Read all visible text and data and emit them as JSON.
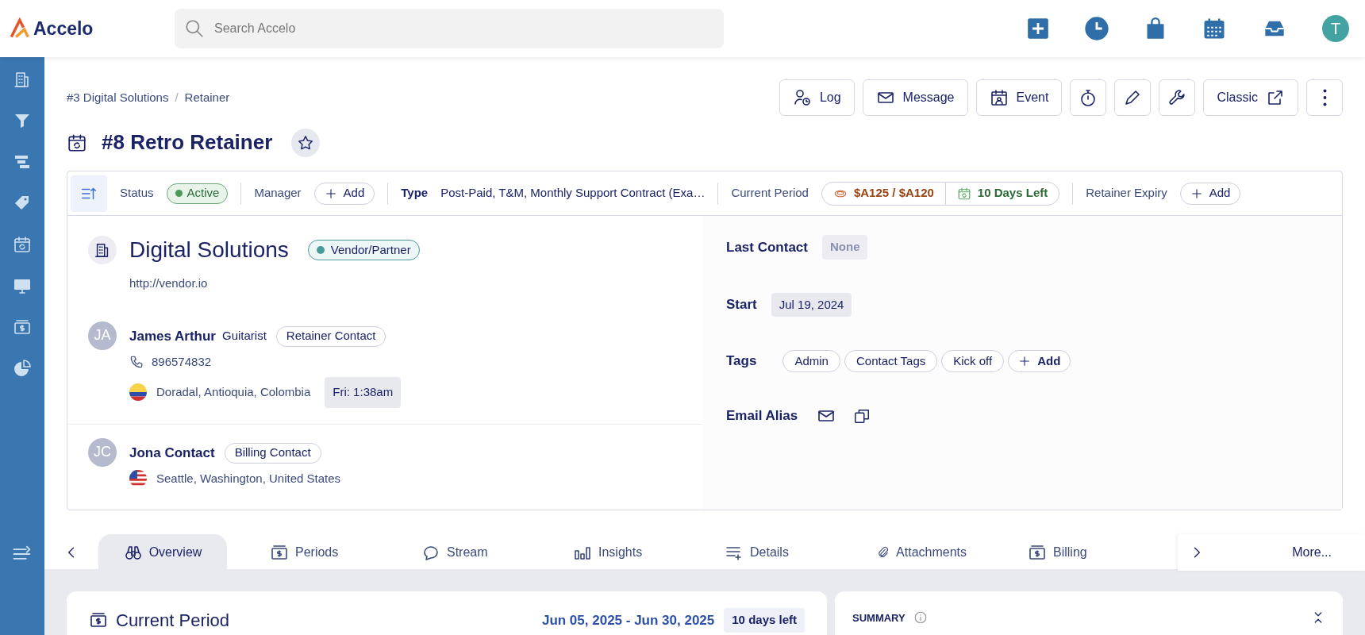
{
  "topbar": {
    "logo": "Accelo",
    "search": {
      "placeholder": "Search Accelo"
    },
    "avatar": "T"
  },
  "sidebar": {
    "items": [
      {
        "selected": false
      },
      {
        "selected": false
      },
      {
        "selected": false
      },
      {
        "selected": false
      },
      {
        "selected": false
      },
      {
        "selected": false
      },
      {
        "selected": false
      },
      {
        "selected": false
      }
    ]
  },
  "breadcrumb": {
    "items": [
      "#3 Digital Solutions",
      "Retainer"
    ],
    "separator": "/"
  },
  "actions": [
    {
      "kind": "text",
      "label": "Log"
    },
    {
      "kind": "text",
      "label": "Message"
    },
    {
      "kind": "text",
      "label": "Event"
    },
    {
      "kind": "icon"
    },
    {
      "kind": "icon"
    },
    {
      "kind": "icon"
    },
    {
      "kind": "text_after",
      "label": "Classic"
    },
    {
      "kind": "icon"
    }
  ],
  "title": "#8 Retro Retainer",
  "starred": false,
  "info_bar": {
    "status_label": "Status",
    "status": "Active",
    "manager_label": "Manager",
    "manager_add": "Add",
    "type_label": "Type",
    "type": "Post-Paid, T&M, Monthly Support Contract (Exa…",
    "period_label": "Current Period",
    "period_amount": "$A125 / $A120",
    "period_days": "10 Days Left",
    "expiry_label": "Retainer Expiry",
    "expiry_add": "Add"
  },
  "company": {
    "name": "Digital Solutions",
    "badge": "Vendor/Partner",
    "url": "http://vendor.io"
  },
  "contacts": [
    {
      "initials": "JA",
      "name": "James Arthur",
      "role": "Guitarist",
      "tag": "Retainer Contact",
      "phone": "896574832",
      "location": "Doradal, Antioquia, Colombia",
      "local_time": "Fri: 1:38am"
    },
    {
      "initials": "JC",
      "name": "Jona Contact",
      "tag": "Billing Contact",
      "location": "Seattle, Washington, United States"
    }
  ],
  "details": {
    "last_contact_label": "Last Contact",
    "last_contact": "None",
    "start_label": "Start",
    "start": "Jul 19, 2024",
    "tags_label": "Tags",
    "tags": [
      "Admin",
      "Contact Tags",
      "Kick off"
    ],
    "tags_add": "Add",
    "email_alias_label": "Email Alias"
  },
  "tabs": [
    {
      "label": "Overview",
      "selected": true
    },
    {
      "label": "Periods",
      "selected": false
    },
    {
      "label": "Stream",
      "selected": false
    },
    {
      "label": "Insights",
      "selected": false
    },
    {
      "label": "Details",
      "selected": false
    },
    {
      "label": "Attachments",
      "selected": false
    },
    {
      "label": "Billing",
      "selected": false
    }
  ],
  "more": "More...",
  "current_period": {
    "title": "Current Period",
    "range": "Jun 05, 2025 - Jun 30, 2025",
    "days_left": "10 days left"
  },
  "summary": {
    "title": "SUMMARY"
  }
}
